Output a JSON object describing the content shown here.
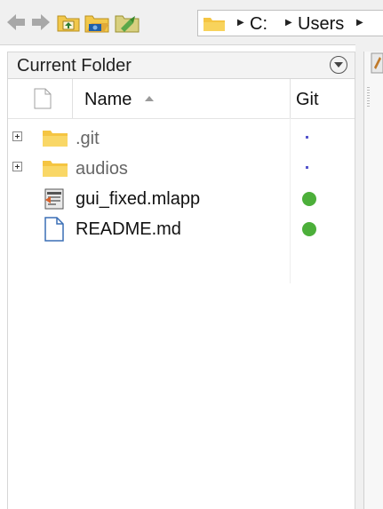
{
  "toolbar": {
    "icons": [
      "back-arrow-icon",
      "forward-arrow-icon",
      "up-folder-icon",
      "browse-folder-icon",
      "refresh-folder-icon"
    ],
    "path": [
      "C:",
      "Users"
    ]
  },
  "panel": {
    "title": "Current Folder",
    "menu_icon": "chevron-down-circle-icon"
  },
  "columns": {
    "name": "Name",
    "git": "Git"
  },
  "files": [
    {
      "name": ".git",
      "type": "folder",
      "expandable": true,
      "git_status": "unmodified",
      "dimmed": true
    },
    {
      "name": "audios",
      "type": "folder",
      "expandable": true,
      "git_status": "unmodified",
      "dimmed": true
    },
    {
      "name": "gui_fixed.mlapp",
      "type": "mlapp",
      "expandable": false,
      "git_status": "tracked",
      "dimmed": false
    },
    {
      "name": "README.md",
      "type": "file",
      "expandable": false,
      "git_status": "tracked",
      "dimmed": false
    }
  ],
  "colors": {
    "git_ok": "#4caf3a",
    "git_unmodified": "#5555cc",
    "folder": "#f5c542",
    "dimmed_text": "#666666"
  }
}
